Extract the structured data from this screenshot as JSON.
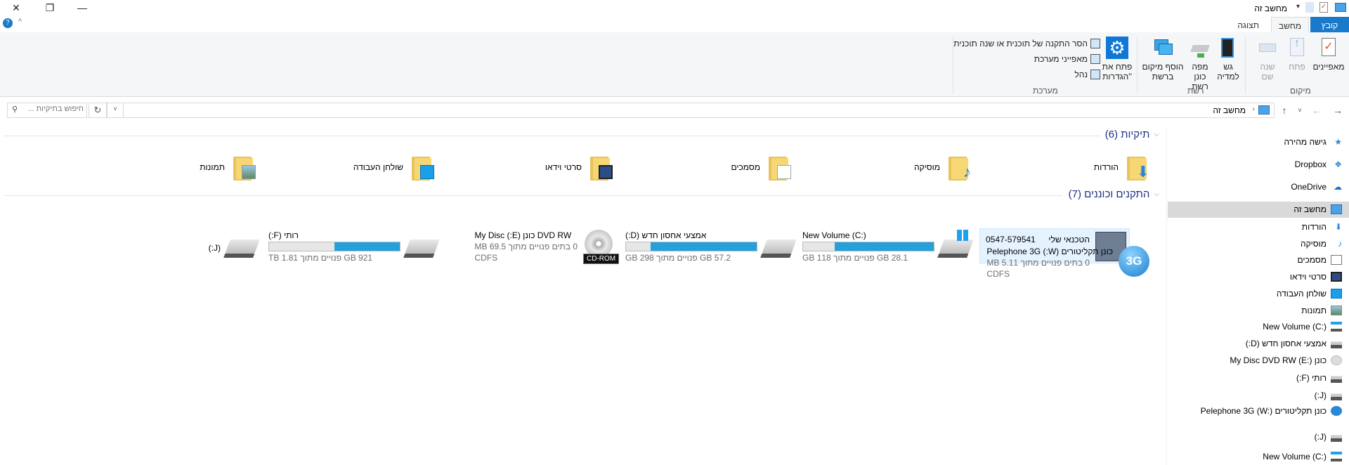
{
  "window": {
    "title": "מחשב זה",
    "close": "✕",
    "restore": "❐",
    "minimize": "—"
  },
  "tabs": {
    "file": "קובץ",
    "computer": "מחשב",
    "view": "תצוגה"
  },
  "ribbon": {
    "location": {
      "label": "מיקום",
      "properties": "מאפיינים",
      "open": "פתח",
      "rename": "שנה שם"
    },
    "network": {
      "label": "רשת",
      "media": "גש למדיה",
      "map_drive": "מפה כונן רשת",
      "add_location": "הוסף מיקום ברשת"
    },
    "system": {
      "label": "מערכת",
      "open_settings": "פתח את 'הגדרות'",
      "uninstall": "הסר התקנה של תוכנית או שנה תוכנית",
      "sys_props": "מאפייני מערכת",
      "manage": "נהל"
    }
  },
  "address": {
    "path": "מחשב זה",
    "search_placeholder": "חיפוש בתיקיות ..."
  },
  "folders": {
    "header": "תיקיות (6)",
    "items": [
      "הורדות",
      "מוסיקה",
      "מסמכים",
      "סרטי וידאו",
      "שולחן העבודה",
      "תמונות"
    ]
  },
  "drives": {
    "header": "התקנים וכוננים (7)",
    "oem": {
      "name": "הטכנאי שלי",
      "phone": "0547-579541"
    },
    "items": [
      {
        "name": "New Volume (C:)",
        "free": "28.1 GB פנויים מתוך 118 GB",
        "used": 0.76
      },
      {
        "name": "אמצעי אחסון חדש (D:)",
        "free": "57.2 GB פנויים מתוך 298 GB",
        "used": 0.81
      },
      {
        "name": "DVD RW כונן (E:) My Disc",
        "free": "0 בתים פנויים מתוך 69.5 MB",
        "fs": "CDFS",
        "tooltip": "CD-ROM"
      },
      {
        "name": "רותי (F:)",
        "free": "921 GB פנויים מתוך 1.81 TB",
        "used": 0.5
      },
      {
        "name": "(J:)"
      },
      {
        "name": "כונן תקליטורים (W:) Pelephone 3G",
        "free": "0 בתים פנויים מתוך 5.11 MB",
        "fs": "CDFS"
      }
    ]
  },
  "nav": {
    "items": [
      "גישה מהירה",
      "Dropbox",
      "OneDrive",
      "מחשב זה",
      "הורדות",
      "מוסיקה",
      "מסמכים",
      "סרטי וידאו",
      "שולחן העבודה",
      "תמונות",
      "New Volume (C:)",
      "אמצעי אחסון חדש (D:)",
      "כונן My Disc DVD RW (E:)",
      "רותי (F:)",
      "(J:)",
      "כונן תקליטורים Pelephone 3G (W:)",
      "(J:)",
      "New Volume (C:)"
    ]
  },
  "colors": {
    "accent": "#1979ca",
    "bar": "#26a0da",
    "selected": "#cce8ff"
  }
}
